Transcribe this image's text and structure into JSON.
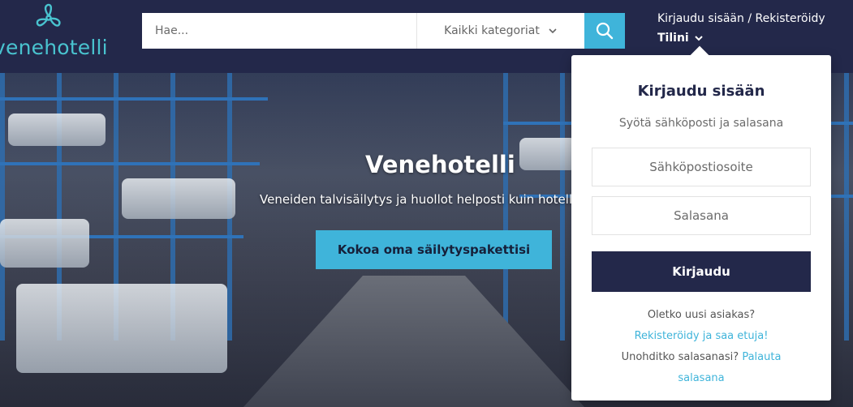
{
  "brand": {
    "name": "venehotelli",
    "logo_icon": "propeller-icon",
    "accent": "#49c3cf"
  },
  "search": {
    "placeholder": "Hae...",
    "category_label": "Kaikki kategoriat",
    "button_icon": "search-icon"
  },
  "account": {
    "auth_link": "Kirjaudu sisään / Rekisteröidy",
    "menu_label": "Tilini"
  },
  "hero": {
    "title": "Venehotelli",
    "subtitle": "Veneiden talvisäilytys ja huollot helposti kuin hotelli",
    "cta_label": "Kokoa oma säilytyspakettisi"
  },
  "login": {
    "title": "Kirjaudu sisään",
    "subtitle": "Syötä sähköposti ja salasana",
    "email_placeholder": "Sähköpostiosoite",
    "password_placeholder": "Salasana",
    "submit_label": "Kirjaudu",
    "new_customer_text": "Oletko uusi asiakas?",
    "register_link": "Rekisteröidy ja saa etuja!",
    "forgot_text": "Unohditko salasanasi?",
    "reset_link_part1": "Palauta",
    "reset_link_part2": "salasana"
  },
  "colors": {
    "header_bg": "#23284a",
    "primary": "#3fb4da",
    "dark_button": "#23284a"
  }
}
